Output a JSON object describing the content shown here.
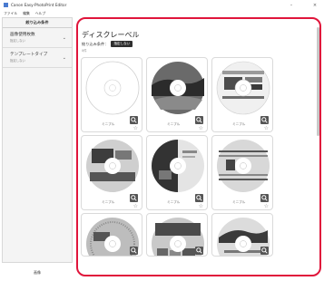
{
  "window": {
    "title": "Canon Easy-PhotoPrint Editor",
    "minimize": "–",
    "close": "×"
  },
  "menu": [
    "ファイル",
    "編集",
    "ヘルプ"
  ],
  "sidebar": {
    "header": "絞り込み条件",
    "filters": [
      {
        "label": "画像使用枚数",
        "value": "指定しない"
      },
      {
        "label": "テンプレートタイプ",
        "value": "指定しない"
      }
    ],
    "bottom_tab": "画像"
  },
  "main": {
    "title": "ディスクレーベル",
    "condition_label": "絞り込み条件：",
    "condition_value": "指定しない",
    "count": "0件"
  },
  "templates": [
    {
      "label": "ミニプル",
      "style": "blank"
    },
    {
      "label": "ミニプル",
      "style": "photo-dark"
    },
    {
      "label": "ミニプル",
      "style": "banner"
    },
    {
      "label": "ミニプル",
      "style": "grey-photo"
    },
    {
      "label": "ミニプル",
      "style": "half-split"
    },
    {
      "label": "ミニプル",
      "style": "stripes"
    },
    {
      "label": "",
      "style": "dotted"
    },
    {
      "label": "",
      "style": "photo-grid"
    },
    {
      "label": "",
      "style": "landscape"
    }
  ],
  "colors": {
    "accent": "#e0153b",
    "badge": "#2f2f2f"
  },
  "icons": {
    "zoom": "magnifier-icon",
    "favorite": "star-icon",
    "filter_expand": "chevron-down-icon"
  }
}
